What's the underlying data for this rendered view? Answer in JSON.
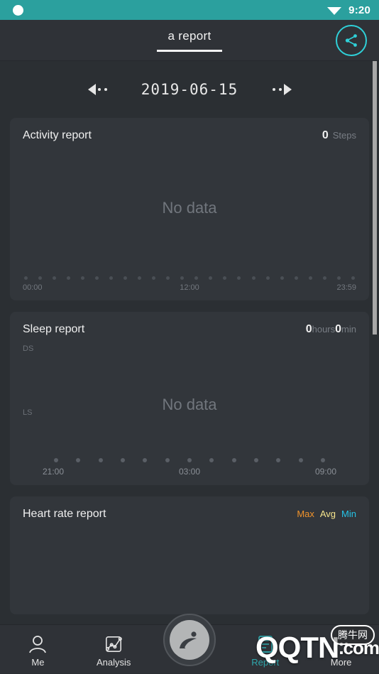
{
  "status_bar": {
    "time": "9:20",
    "wifi_icon": "wifi-icon",
    "recording_dot_icon": "recording-dot-icon",
    "background_color": "#2ba09e"
  },
  "app_bar": {
    "tab_label": "a report",
    "share_icon": "share-icon",
    "accent_color": "#2fd0d8"
  },
  "date_nav": {
    "prev_label": "previous-day",
    "next_label": "next-day",
    "date": "2019-06-15"
  },
  "cards": {
    "activity": {
      "title": "Activity report",
      "value": "0",
      "unit": "Steps",
      "empty_text": "No data",
      "axis": {
        "start": "00:00",
        "middle": "12:00",
        "end": "23:59",
        "tick_count": 24
      }
    },
    "sleep": {
      "title": "Sleep report",
      "hours_value": "0",
      "hours_unit": "hours",
      "minutes_value": "0",
      "minutes_unit": "min",
      "deep_sleep_label": "DS",
      "light_sleep_label": "LS",
      "empty_text": "No data",
      "axis": {
        "start": "21:00",
        "middle": "03:00",
        "end": "09:00",
        "tick_count": 13
      }
    },
    "heart_rate": {
      "title": "Heart rate report",
      "legend": [
        {
          "label": "Max",
          "color": "#f0932b"
        },
        {
          "label": "Avg",
          "color": "#f6e58d"
        },
        {
          "label": "Min",
          "color": "#25c4e8"
        }
      ]
    }
  },
  "bottom_nav": {
    "items": [
      {
        "label": "Me",
        "icon": "person-icon",
        "active": false
      },
      {
        "label": "Analysis",
        "icon": "chart-icon",
        "active": false
      },
      {
        "label": "Report",
        "icon": "document-icon",
        "active": true
      },
      {
        "label": "More",
        "icon": "more-icon",
        "active": false
      }
    ],
    "fab_icon": "runner-logo-icon",
    "active_color": "#2fa8ad"
  },
  "watermark": {
    "brand": "QQTN",
    "suffix": ".com",
    "bubble": "腾牛网"
  }
}
